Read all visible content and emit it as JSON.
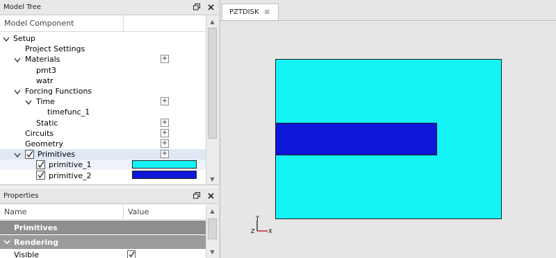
{
  "model_tree": {
    "title": "Model Tree",
    "column_header": "Model Component",
    "items": [
      {
        "label": "Setup",
        "level": 0,
        "expanded": true
      },
      {
        "label": "Project Settings",
        "level": 1
      },
      {
        "label": "Materials",
        "level": 1,
        "expanded": true,
        "has_add": true
      },
      {
        "label": "pmt3",
        "level": 2
      },
      {
        "label": "watr",
        "level": 2
      },
      {
        "label": "Forcing Functions",
        "level": 1,
        "expanded": true
      },
      {
        "label": "Time",
        "level": 2,
        "expanded": true,
        "has_add": true
      },
      {
        "label": "timefunc_1",
        "level": 3
      },
      {
        "label": "Static",
        "level": 2,
        "has_add": true
      },
      {
        "label": "Circuits",
        "level": 1,
        "has_add": true
      },
      {
        "label": "Geometry",
        "level": 1,
        "has_add": true
      },
      {
        "label": "Primitives",
        "level": 1,
        "expanded": true,
        "checked": true,
        "has_add": true
      },
      {
        "label": "primitive_1",
        "level": 2,
        "checked": true,
        "color": "#14f3f5"
      },
      {
        "label": "primitive_2",
        "level": 2,
        "checked": true,
        "color": "#0c17d7"
      }
    ],
    "add_symbol": "+"
  },
  "properties": {
    "title": "Properties",
    "col_name": "Name",
    "col_value": "Value",
    "groups": [
      "Primitives",
      "Rendering"
    ],
    "rows": [
      {
        "name": "Visible",
        "checked": true
      }
    ]
  },
  "editor": {
    "tab_label": "PZTDISK",
    "tab_close": "⊠",
    "axis_y": "Y",
    "axis_z": "Z",
    "axis_x": "X"
  },
  "colors": {
    "outer_rect": "#14f3f5",
    "inner_rect": "#0c17d7"
  }
}
